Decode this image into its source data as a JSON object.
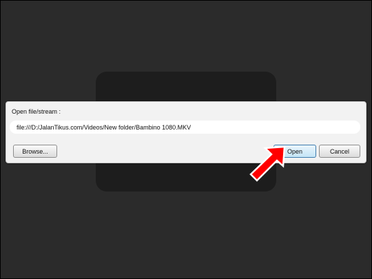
{
  "dialog": {
    "label": "Open file/stream :",
    "path_value": "file:///D:/JalanTikus.com/Videos/New folder/Bambino 1080.MKV",
    "browse_label": "Browse...",
    "open_label": "Open",
    "cancel_label": "Cancel"
  },
  "annotation": {
    "arrow_icon": "red-arrow-icon",
    "arrow_color": "#ff0000"
  },
  "colors": {
    "background": "#2b2b2b",
    "panel": "#1d1d1d",
    "dialog": "#f2f2f2",
    "open_button_border": "#3d7bad"
  }
}
